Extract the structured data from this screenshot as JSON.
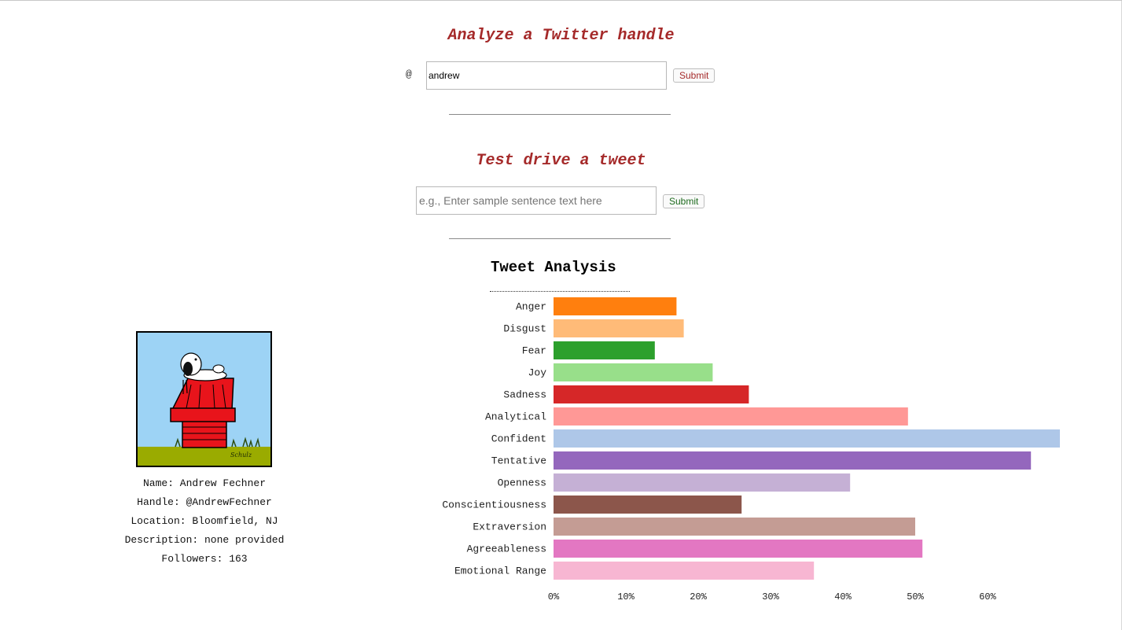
{
  "handle_form": {
    "heading": "Analyze a Twitter handle",
    "at_symbol": "@",
    "value": "andrew",
    "submit_label": "Submit"
  },
  "tweet_form": {
    "heading": "Test drive a tweet",
    "value": "",
    "placeholder": "e.g., Enter sample sentence text here",
    "submit_label": "Submit"
  },
  "profile": {
    "avatar_icon": "snoopy-doghouse-icon",
    "signature": "Schulz",
    "name_line": "Name: Andrew Fechner",
    "handle_line": "Handle: @AndrewFechner",
    "location_line": "Location: Bloomfield, NJ",
    "description_line": "Description: none provided",
    "followers_line": "Followers: 163"
  },
  "chart_data": {
    "type": "bar",
    "orientation": "horizontal",
    "title": "Tweet Analysis",
    "categories": [
      "Anger",
      "Disgust",
      "Fear",
      "Joy",
      "Sadness",
      "Analytical",
      "Confident",
      "Tentative",
      "Openness",
      "Conscientiousness",
      "Extraversion",
      "Agreeableness",
      "Emotional Range"
    ],
    "values": [
      17,
      18,
      14,
      22,
      27,
      49,
      70,
      66,
      41,
      26,
      50,
      51,
      36
    ],
    "colors": [
      "#ff7f0e",
      "#ffbb78",
      "#2ca02c",
      "#98df8a",
      "#d62728",
      "#ff9896",
      "#aec7e8",
      "#9467bd",
      "#c5b0d5",
      "#8c564b",
      "#c49c94",
      "#e377c2",
      "#f7b6d2"
    ],
    "x_ticks": [
      "0%",
      "10%",
      "20%",
      "30%",
      "40%",
      "50%",
      "60%"
    ],
    "x_tick_values": [
      0,
      10,
      20,
      30,
      40,
      50,
      60
    ],
    "xlim": [
      0,
      70
    ],
    "grid": false,
    "legend": "none"
  }
}
